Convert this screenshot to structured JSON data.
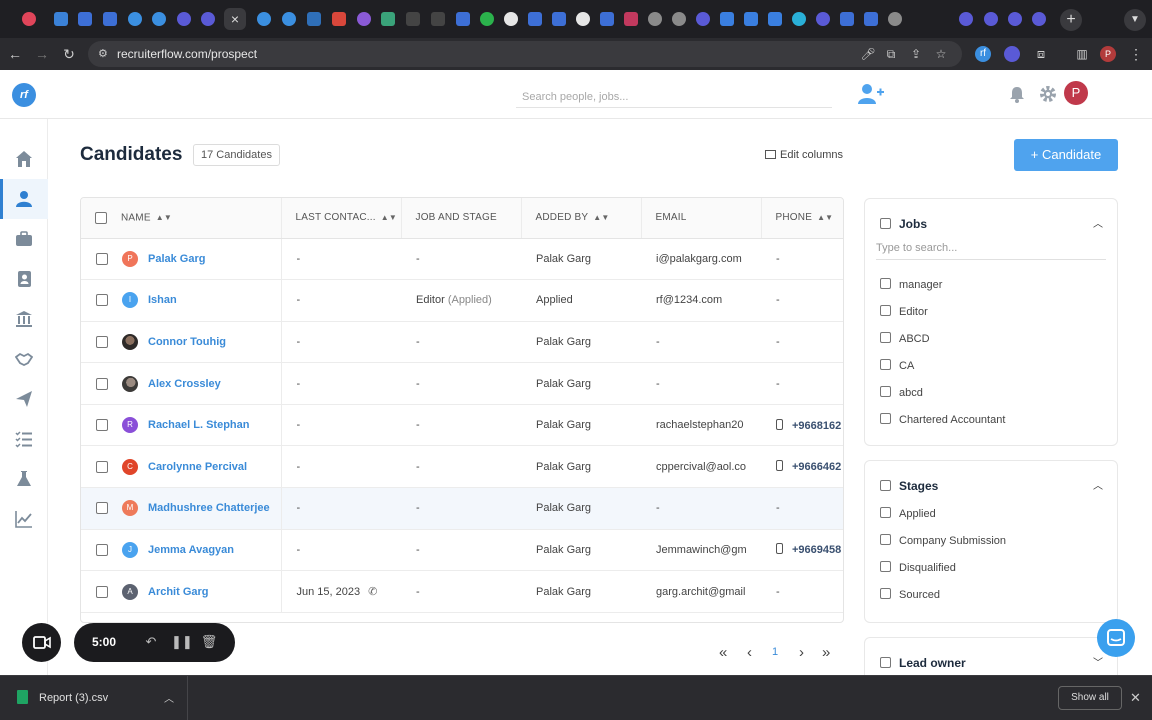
{
  "browser": {
    "url": "recruiterflow.com/prospect",
    "profile_initial": "P"
  },
  "header": {
    "logo_text": "rf",
    "search_placeholder": "Search people, jobs...",
    "avatar_initial": "P"
  },
  "page": {
    "title": "Candidates",
    "count_label": "17 Candidates",
    "edit_columns_label": "Edit columns",
    "add_button_label": "+ Candidate"
  },
  "table": {
    "columns": [
      "NAME",
      "LAST CONTAC...",
      "JOB AND STAGE",
      "ADDED BY",
      "EMAIL",
      "PHONE"
    ],
    "rows": [
      {
        "initial": "P",
        "color": "#f0755a",
        "name": "Palak Garg",
        "last": "-",
        "job": "-",
        "job_stage": "",
        "added_by": "Palak Garg",
        "email": "i@palakgarg.com",
        "phone": "-"
      },
      {
        "initial": "I",
        "color": "#4aa3ef",
        "name": "Ishan",
        "last": "-",
        "job": "Editor",
        "job_stage": "(Applied)",
        "added_by": "Applied",
        "email": "rf@1234.com",
        "phone": "-"
      },
      {
        "initial": "",
        "color": "#2e2a28",
        "name": "Connor Touhig",
        "last": "-",
        "job": "-",
        "job_stage": "",
        "added_by": "Palak Garg",
        "email": "-",
        "phone": "-"
      },
      {
        "initial": "",
        "color": "#3c3a38",
        "name": "Alex Crossley",
        "last": "-",
        "job": "-",
        "job_stage": "",
        "added_by": "Palak Garg",
        "email": "-",
        "phone": "-"
      },
      {
        "initial": "R",
        "color": "#8a4fd8",
        "name": "Rachael L. Stephan",
        "last": "-",
        "job": "-",
        "job_stage": "",
        "added_by": "Palak Garg",
        "email": "rachaelstephan20",
        "phone": "+9668162"
      },
      {
        "initial": "C",
        "color": "#e0452a",
        "name": "Carolynne Percival",
        "last": "-",
        "job": "-",
        "job_stage": "",
        "added_by": "Palak Garg",
        "email": "cppercival@aol.co",
        "phone": "+9666462"
      },
      {
        "initial": "M",
        "color": "#ee7a5a",
        "name": "Madhushree Chatterjee",
        "last": "-",
        "job": "-",
        "job_stage": "",
        "added_by": "Palak Garg",
        "email": "-",
        "phone": "-"
      },
      {
        "initial": "J",
        "color": "#4aa3ef",
        "name": "Jemma Avagyan",
        "last": "-",
        "job": "-",
        "job_stage": "",
        "added_by": "Palak Garg",
        "email": "Jemmawinch@gm",
        "phone": "+9669458"
      },
      {
        "initial": "A",
        "color": "#5c6270",
        "name": "Archit Garg",
        "last": "Jun 15, 2023",
        "job": "-",
        "job_stage": "",
        "added_by": "Palak Garg",
        "email": "garg.archit@gmail",
        "phone": "-"
      }
    ]
  },
  "pagination": {
    "current_page": "1"
  },
  "filters": {
    "jobs": {
      "title": "Jobs",
      "search_placeholder": "Type to search...",
      "options": [
        "manager",
        "Editor",
        "ABCD",
        "CA",
        "abcd",
        "Chartered Accountant"
      ]
    },
    "stages": {
      "title": "Stages",
      "options": [
        "Applied",
        "Company Submission",
        "Disqualified",
        "Sourced"
      ]
    },
    "lead_owner": {
      "title": "Lead owner"
    }
  },
  "recorder": {
    "timer": "5:00"
  },
  "downloads": {
    "file_name": "Report (3).csv",
    "show_all_label": "Show all"
  },
  "colors": {
    "accent": "#3a8bd8",
    "primary_button": "#4fa3ee",
    "browser_dark": "#1f1f23"
  }
}
